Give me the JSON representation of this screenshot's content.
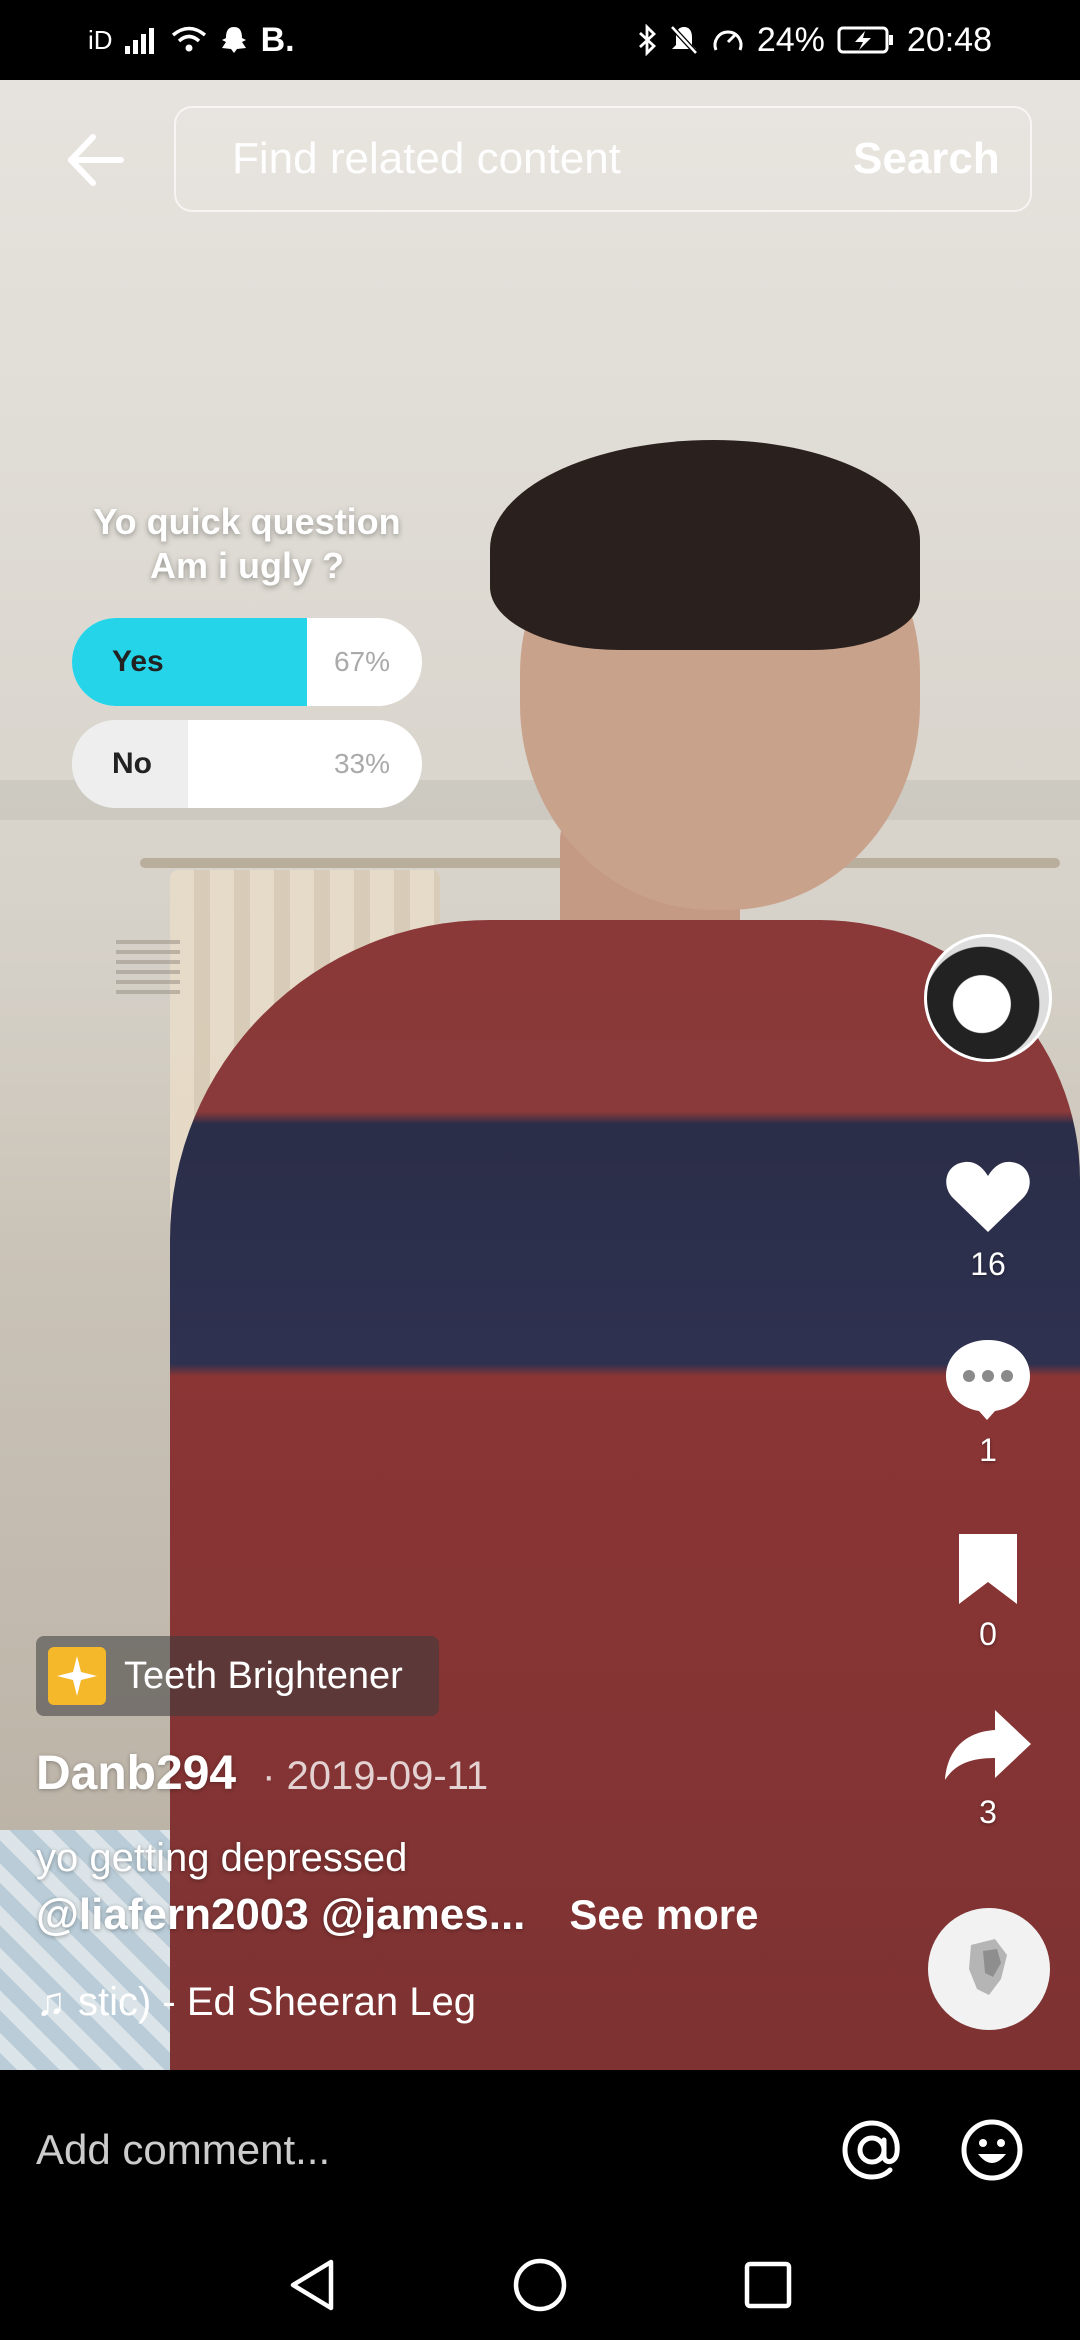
{
  "status_bar": {
    "carrier": "iD",
    "snapchat_badge": "B.",
    "battery": "24%",
    "time": "20:48"
  },
  "search": {
    "placeholder": "Find related content",
    "button_label": "Search"
  },
  "poll": {
    "question_line1": "Yo quick question",
    "question_line2": "Am i ugly ?",
    "options": [
      {
        "label": "Yes",
        "percent": "67%",
        "fraction": 0.67,
        "color": "#25d4e8"
      },
      {
        "label": "No",
        "percent": "33%",
        "fraction": 0.33,
        "color": "#eeeeee"
      }
    ]
  },
  "actions": {
    "likes": "16",
    "comments": "1",
    "saves": "0",
    "shares": "3"
  },
  "effect": {
    "label": "Teeth Brightener"
  },
  "post": {
    "author": "Danb294",
    "date": "· 2019-09-11",
    "caption": "yo getting depressed",
    "mentions": "@liafern2003 @james...",
    "see_more": "See more",
    "music": "stic) - Ed Sheeran    Leg"
  },
  "comment_bar": {
    "placeholder": "Add comment..."
  },
  "colors": {
    "poll_accent": "#25d4e8",
    "effect_tag": "#f4b82a"
  }
}
